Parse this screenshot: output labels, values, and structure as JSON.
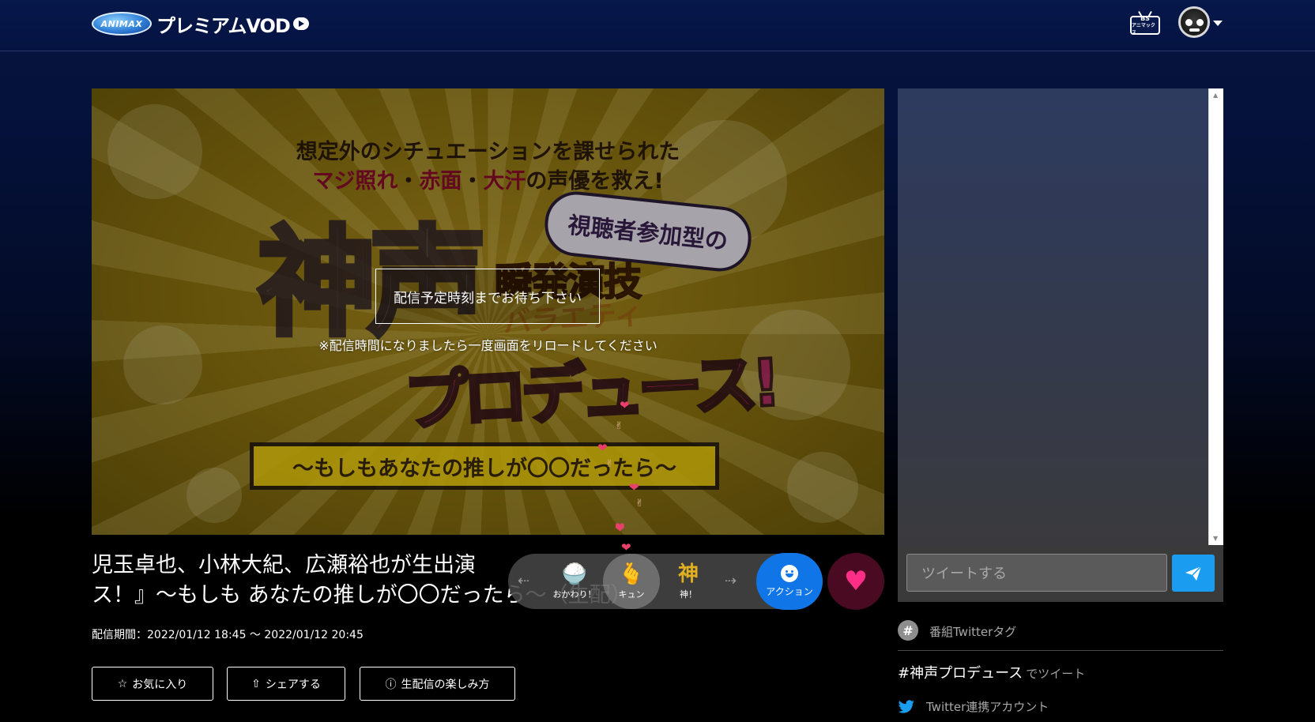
{
  "header": {
    "logo_badge": "ANIMAX",
    "logo_text": "プレミアムVOD",
    "bs_label_1": "BS",
    "bs_label_2": "アニマックス",
    "avatar_icon": "user-avatar-icon"
  },
  "video": {
    "overlay_box_text": "配信予定時刻までお待ち下さい",
    "overlay_note": "※配信時間になりましたら一度画面をリロードしてください",
    "art_line1": "想定外のシチュエーションを課せられた",
    "art_line2a": "マジ照れ",
    "art_line2b": "・",
    "art_line2c": "赤面",
    "art_line2d": "・",
    "art_line2e": "大汗",
    "art_line2f": "の声優を救え!",
    "art_cloud": "視聴者参加型の",
    "art_kamigoe": "神声",
    "art_shunpatsu": "瞬発演技",
    "art_variety": "バラエティ",
    "art_produce": "プロデュース!",
    "art_sub": "〜もしもあなたの推しが〇〇だったら〜"
  },
  "program": {
    "title": "児玉卓也、小林大紀、広瀬裕也が生出演 ス！』〜もしも あなたの推しが〇〇だったら〜（生配）",
    "title_line1": "児玉卓也、小林大紀、広瀬裕也が生出演",
    "title_line2": "ス！』〜もしも あなたの推しが〇〇だったら〜（生配）",
    "period": "配信期間：2022/01/12 18:45 〜 2022/01/12 20:45"
  },
  "buttons": {
    "favorite": "お気に入り",
    "share": "シェアする",
    "howto": "生配信の楽しみ方"
  },
  "reactions": [
    {
      "label": "おかわり！",
      "icon": "rice-bowl-icon",
      "glyph": "🍚"
    },
    {
      "label": "キュン",
      "icon": "finger-heart-icon",
      "glyph": "🫰"
    },
    {
      "label": "神！",
      "icon": "kami-icon",
      "glyph": "神"
    }
  ],
  "action": {
    "label": "アクション"
  },
  "twitter": {
    "tweet_placeholder": "ツイートする",
    "tag_section_label": "番組Twitterタグ",
    "hashtag": "#神声プロデュース",
    "hashtag_suffix": "でツイート",
    "account_label": "Twitter連携アカウント"
  },
  "colors": {
    "action_blue": "#1076e8",
    "like_pink": "#ff2f88",
    "tweet_send_blue": "#1a9cf0"
  }
}
